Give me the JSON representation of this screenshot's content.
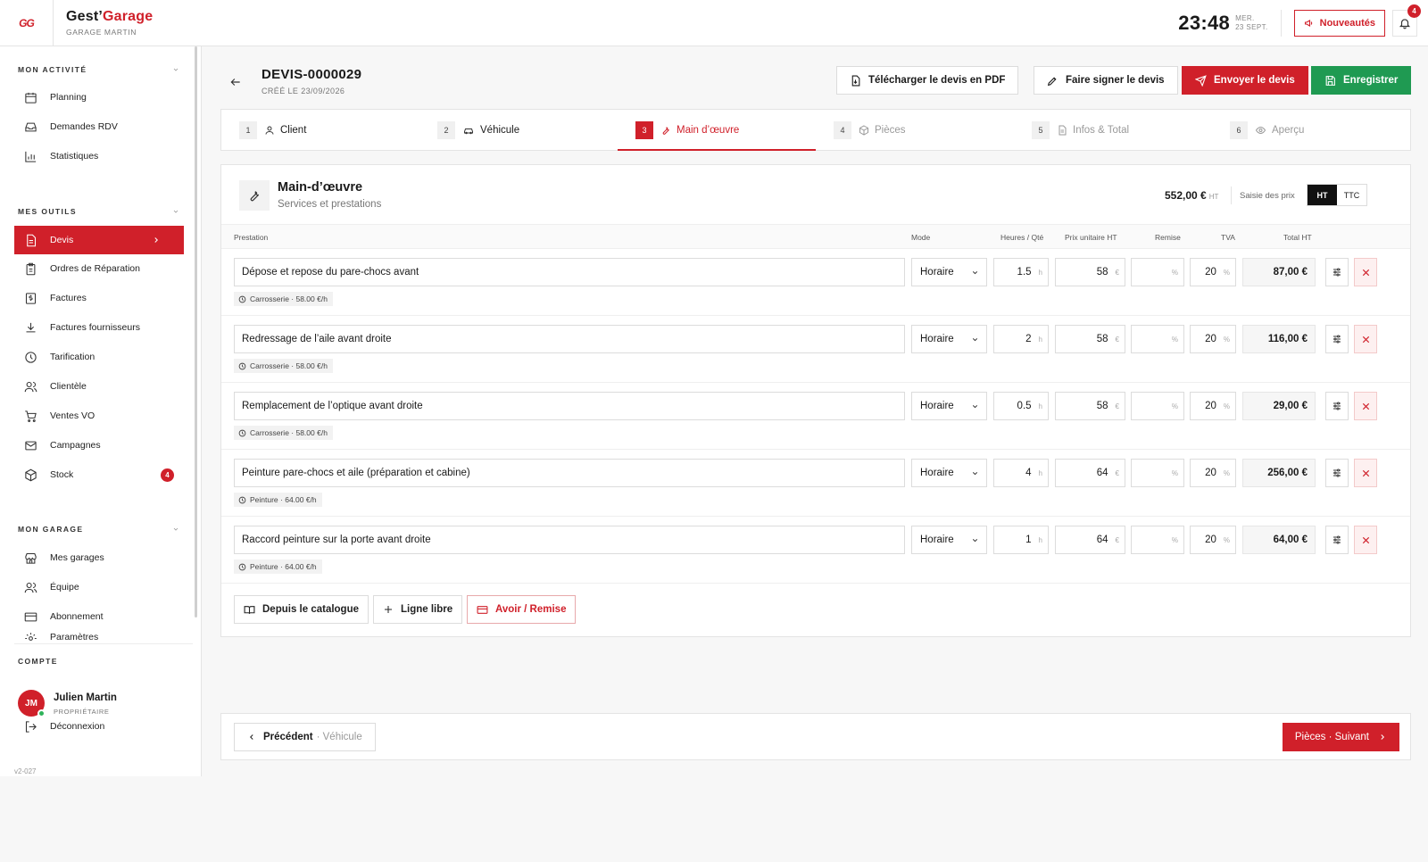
{
  "app": {
    "logo": "GG",
    "name_prefix": "Gest’",
    "name_accent": "Garage",
    "subtitle": "GARAGE MARTIN"
  },
  "topbar": {
    "time": "23:48",
    "day": "MER.",
    "date": "23 SEPT.",
    "news_label": "Nouveautés",
    "notif_count": "4"
  },
  "sidebar": {
    "sec_activity": "MON ACTIVITÉ",
    "activity": [
      "Planning",
      "Demandes RDV",
      "Statistiques"
    ],
    "sec_tools": "MES OUTILS",
    "tools": [
      "Devis",
      "Ordres de Réparation",
      "Factures",
      "Factures fournisseurs",
      "Tarification",
      "Clientèle",
      "Ventes VO",
      "Campagnes",
      "Stock"
    ],
    "stock_badge": "4",
    "sec_garage": "MON GARAGE",
    "garage": [
      "Mes garages",
      "Équipe",
      "Abonnement",
      "Paramètres"
    ],
    "sec_account": "COMPTE",
    "user": {
      "initials": "JM",
      "name": "Julien Martin",
      "role": "PROPRIÉTAIRE"
    },
    "logout": "Déconnexion",
    "version": "v2-027"
  },
  "header": {
    "title": "DEVIS-0000029",
    "created": "CRÉÉ LE 23/09/2026",
    "btn_pdf": "Télécharger le devis en PDF",
    "btn_sign": "Faire signer le devis",
    "btn_send": "Envoyer le devis",
    "btn_save": "Enregistrer"
  },
  "steps": [
    {
      "num": "1",
      "label": "Client"
    },
    {
      "num": "2",
      "label": "Véhicule"
    },
    {
      "num": "3",
      "label": "Main d’œuvre"
    },
    {
      "num": "4",
      "label": "Pièces"
    },
    {
      "num": "5",
      "label": "Infos & Total"
    },
    {
      "num": "6",
      "label": "Aperçu"
    }
  ],
  "section": {
    "title": "Main-d’œuvre",
    "subtitle": "Services et prestations",
    "total": "552,00 €",
    "total_unit": "HT",
    "price_mode_label": "Saisie des prix",
    "mode_ht": "HT",
    "mode_ttc": "TTC"
  },
  "columns": {
    "prestation": "Prestation",
    "mode": "Mode",
    "hours": "Heures / Qté",
    "unit_price": "Prix unitaire HT",
    "discount": "Remise",
    "vat": "TVA",
    "total": "Total HT"
  },
  "units": {
    "h": "h",
    "eur": "€",
    "pct": "%"
  },
  "rows": [
    {
      "desc": "Dépose et repose du pare-chocs avant",
      "mode": "Horaire",
      "hours": "1.5",
      "price": "58",
      "discount": "",
      "vat": "20",
      "total": "87,00 €",
      "tag": "Carrosserie · 58.00 €/h"
    },
    {
      "desc": "Redressage de l’aile avant droite",
      "mode": "Horaire",
      "hours": "2",
      "price": "58",
      "discount": "",
      "vat": "20",
      "total": "116,00 €",
      "tag": "Carrosserie · 58.00 €/h"
    },
    {
      "desc": "Remplacement de l’optique avant droite",
      "mode": "Horaire",
      "hours": "0.5",
      "price": "58",
      "discount": "",
      "vat": "20",
      "total": "29,00 €",
      "tag": "Carrosserie · 58.00 €/h"
    },
    {
      "desc": "Peinture pare-chocs et aile (préparation et cabine)",
      "mode": "Horaire",
      "hours": "4",
      "price": "64",
      "discount": "",
      "vat": "20",
      "total": "256,00 €",
      "tag": "Peinture · 64.00 €/h"
    },
    {
      "desc": "Raccord peinture sur la porte avant droite",
      "mode": "Horaire",
      "hours": "1",
      "price": "64",
      "discount": "",
      "vat": "20",
      "total": "64,00 €",
      "tag": "Peinture · 64.00 €/h"
    }
  ],
  "actions": {
    "catalog": "Depuis le catalogue",
    "free_line": "Ligne libre",
    "credit": "Avoir / Remise"
  },
  "footer": {
    "prev_label": "Précédent",
    "prev_target": "· Véhicule",
    "next_label": "Pièces · Suivant"
  },
  "colors": {
    "accent": "#d0202a",
    "success": "#1f9a52"
  }
}
